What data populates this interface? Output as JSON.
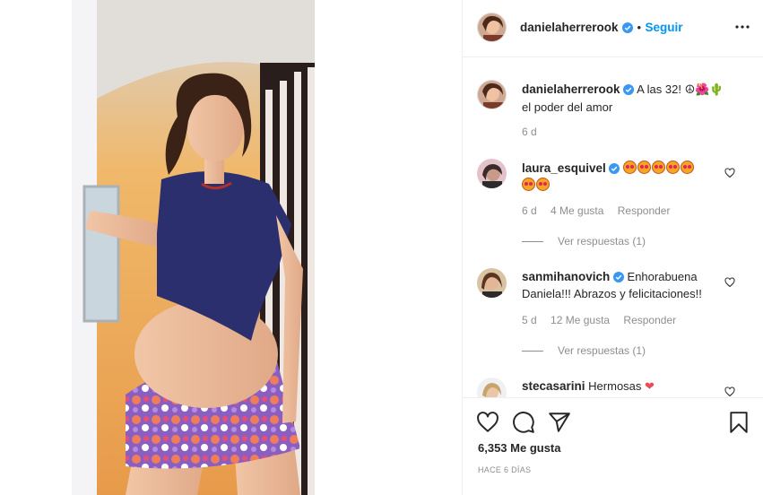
{
  "post": {
    "author": "danielaherrerook",
    "follow_label": "Seguir",
    "separator": "•",
    "caption_user": "danielaherrerook",
    "caption_line1": "A las 32! ",
    "caption_emoji": "☮🌺🌵",
    "caption_line2": "el poder del amor",
    "caption_time": "6 d"
  },
  "comments": [
    {
      "user": "laura_esquivel",
      "text": "",
      "emoji_count": 7,
      "time": "6 d",
      "likes": "4 Me gusta",
      "reply": "Responder",
      "view_replies": "Ver respuestas (1)"
    },
    {
      "user": "sanmihanovich",
      "text_line1": "Enhorabuena",
      "text_line2": "Daniela!!! Abrazos y felicitaciones!!",
      "time": "5 d",
      "likes": "12 Me gusta",
      "reply": "Responder",
      "view_replies": "Ver respuestas (1)"
    },
    {
      "user": "stecasarini",
      "text": "Hermosas",
      "emoji": "❤"
    }
  ],
  "footer": {
    "likes": "6,353 Me gusta",
    "date": "HACE 6 DÍAS"
  },
  "colors": {
    "accent": "#0095f6",
    "verified": "#3897f0",
    "muted": "#8e8e8e",
    "text": "#262626",
    "heart_red": "#ed4956"
  },
  "icons": [
    "more-icon",
    "heart-icon",
    "comment-icon",
    "share-icon",
    "bookmark-icon",
    "verified-icon"
  ]
}
